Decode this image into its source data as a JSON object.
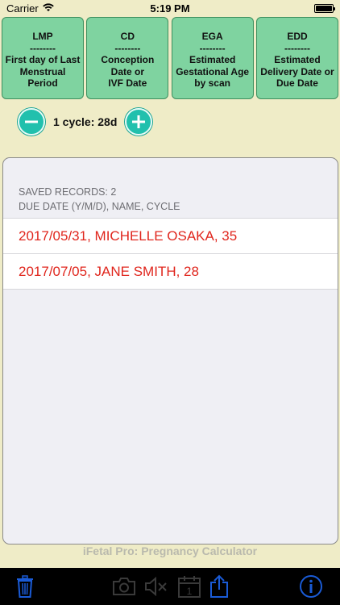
{
  "status": {
    "carrier": "Carrier",
    "time": "5:19 PM"
  },
  "modes": [
    {
      "title": "LMP",
      "sep": "--------",
      "desc": "First day of Last\nMenstrual\nPeriod"
    },
    {
      "title": "CD",
      "sep": "--------",
      "desc": "Conception\nDate or\nIVF Date"
    },
    {
      "title": "EGA",
      "sep": "--------",
      "desc": "Estimated\nGestational Age\nby scan"
    },
    {
      "title": "EDD",
      "sep": "--------",
      "desc": "Estimated\nDelivery Date or\nDue Date"
    }
  ],
  "cycle": {
    "label": "1 cycle: 28d"
  },
  "records": {
    "count_label": "SAVED RECORDS: 2",
    "columns_label": "DUE DATE (Y/M/D), NAME, CYCLE",
    "rows": [
      "2017/05/31, MICHELLE OSAKA, 35",
      "2017/07/05, JANE SMITH, 28"
    ]
  },
  "footer": {
    "title": "iFetal Pro: Pregnancy Calculator"
  },
  "toolbar": {
    "icons": [
      "trash-icon",
      "camera-icon",
      "mute-icon",
      "calendar-icon",
      "share-icon",
      "info-icon"
    ],
    "calendar_day": "1",
    "active_color": "#1a5bd6",
    "disabled_color": "#3a3a3a"
  }
}
